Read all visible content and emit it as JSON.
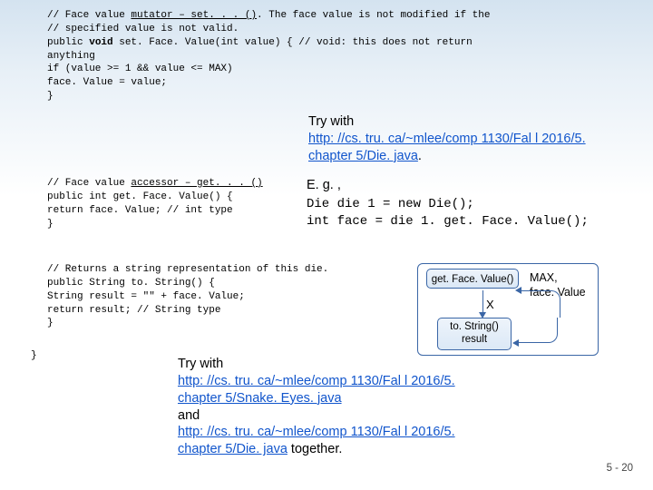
{
  "code1": {
    "c1": "//  Face value ",
    "c1u": "mutator – set. . . ()",
    "c1b": ". The face value is not modified if the",
    "c2": "//  specified value is not valid.",
    "c3a": "public ",
    "c3kw": "void",
    "c3b": " set. Face. Value(int value) {  // void: this does not return",
    "c4": "anything",
    "c5": "    if (value >= 1 && value <= MAX)",
    "c6": "        face. Value = value;",
    "c7": "}"
  },
  "note1": {
    "try": "Try with",
    "link": "http: //cs. tru. ca/~mlee/comp 1130/Fal l 2016/5. chapter 5/Die. java",
    "dot": "."
  },
  "code2": {
    "c1": "//  Face value ",
    "c1u": "accessor – get. . . ()",
    "c2": "public int get. Face. Value() {",
    "c3": "    return face. Value;  // int type",
    "c4": "}"
  },
  "eg": {
    "l1": "E. g. ,",
    "l2": "Die die 1 = new Die();",
    "l3": " int face = die 1. get. Face. Value();"
  },
  "code3": {
    "c1": "//  Returns a string representation of this die.",
    "c2": "public String to. String() {",
    "c3": "    String result = \"\" + face. Value;",
    "c4": "    return result;  // String type",
    "c5": "}"
  },
  "closebrace": "}",
  "try2": {
    "try": "Try with",
    "link1": "http: //cs. tru. ca/~mlee/comp 1130/Fal l 2016/5. chapter 5/Snake. Eyes. java",
    "and": "and",
    "link2": "http: //cs. tru. ca/~mlee/comp 1130/Fal l 2016/5. chapter 5/Die. java",
    "together": " together."
  },
  "diagram": {
    "getFace": "get. Face. Value()",
    "tostring1": "to. String()",
    "tostring2": "result",
    "x": "X",
    "max": "MAX,\nface. Value"
  },
  "pagenum": "5 - 20"
}
